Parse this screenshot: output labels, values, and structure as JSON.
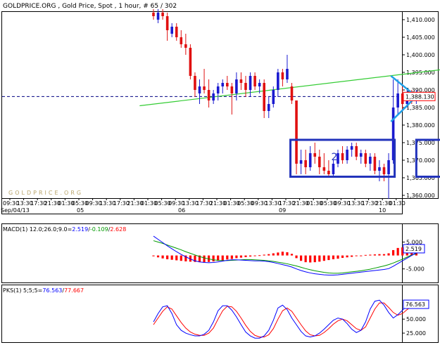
{
  "header": {
    "title": "GOLDPRICE.ORG , Gold Price, Spot , 1 hour, # 65 / 302"
  },
  "watermark": "GOLDPRICE.ORG",
  "colors": {
    "up_candle": "#1a1ad0",
    "down_candle": "#e01010",
    "trendline": "#33cc33",
    "box": "#2233bb",
    "triangle": "#1fa0e8",
    "price_line": "#000080",
    "macd_hist": "#ff0000",
    "macd_line": "#0000ff",
    "signal_line": "#009900",
    "pks_k": "#0000ff",
    "pks_d": "#ff0000",
    "price_tag_border": "#ff0000"
  },
  "annotations": {
    "box2_label": "2"
  },
  "chart_data": [
    {
      "type": "candlestick",
      "title": "GOLDPRICE.ORG , Gold Price, Spot , 1 hour, # 65 / 302",
      "y_ticks": [
        "1,410.000",
        "1,405.000",
        "1,400.000",
        "1,395.000",
        "1,390.000",
        "1,385.000",
        "1,380.000",
        "1,375.000",
        "1,370.000",
        "1,365.000",
        "1,360.000"
      ],
      "ylim": [
        1357.5,
        1413.5
      ],
      "current_price": 1388.13,
      "current_price_label": "1,388.130",
      "x_time_labels": [
        "09:30",
        "13:30",
        "17:30",
        "21:30",
        "01:30",
        "05:30",
        "09:30",
        "13:30",
        "17:30",
        "21:30",
        "01:30",
        "05:30",
        "09:30",
        "13:30",
        "17:30",
        "21:30",
        "01:30",
        "05:30",
        "09:30",
        "13:30",
        "17:30",
        "21:30",
        "01:30",
        "05:30",
        "09:30",
        "13:30",
        "17:30",
        "21:30",
        "01:30"
      ],
      "x_date_labels": [
        "Sep/04/13",
        "05",
        "06",
        "09",
        "10"
      ],
      "candles": [
        {
          "o": 1412,
          "h": 1413,
          "l": 1410,
          "c": 1411
        },
        {
          "o": 1410,
          "h": 1413,
          "l": 1409,
          "c": 1412
        },
        {
          "o": 1412,
          "h": 1413,
          "l": 1410,
          "c": 1411
        },
        {
          "o": 1411,
          "h": 1412,
          "l": 1404,
          "c": 1407
        },
        {
          "o": 1406,
          "h": 1409,
          "l": 1405,
          "c": 1408
        },
        {
          "o": 1408,
          "h": 1409,
          "l": 1404,
          "c": 1405
        },
        {
          "o": 1405,
          "h": 1407,
          "l": 1402,
          "c": 1403
        },
        {
          "o": 1403,
          "h": 1406,
          "l": 1400,
          "c": 1402
        },
        {
          "o": 1402,
          "h": 1403,
          "l": 1393,
          "c": 1394
        },
        {
          "o": 1394,
          "h": 1395,
          "l": 1388,
          "c": 1390
        },
        {
          "o": 1389,
          "h": 1393,
          "l": 1386,
          "c": 1391
        },
        {
          "o": 1391,
          "h": 1396,
          "l": 1389,
          "c": 1390
        },
        {
          "o": 1390,
          "h": 1393,
          "l": 1385,
          "c": 1387
        },
        {
          "o": 1387,
          "h": 1390,
          "l": 1386,
          "c": 1389
        },
        {
          "o": 1389,
          "h": 1392,
          "l": 1387,
          "c": 1391
        },
        {
          "o": 1391,
          "h": 1393,
          "l": 1389,
          "c": 1392
        },
        {
          "o": 1392,
          "h": 1394,
          "l": 1390,
          "c": 1391
        },
        {
          "o": 1391,
          "h": 1392,
          "l": 1383,
          "c": 1389
        },
        {
          "o": 1389,
          "h": 1395,
          "l": 1387,
          "c": 1393
        },
        {
          "o": 1393,
          "h": 1395,
          "l": 1390,
          "c": 1392
        },
        {
          "o": 1392,
          "h": 1394,
          "l": 1388,
          "c": 1390
        },
        {
          "o": 1390,
          "h": 1395,
          "l": 1388,
          "c": 1394
        },
        {
          "o": 1394,
          "h": 1395,
          "l": 1390,
          "c": 1391
        },
        {
          "o": 1391,
          "h": 1393,
          "l": 1389,
          "c": 1392
        },
        {
          "o": 1392,
          "h": 1393,
          "l": 1382,
          "c": 1384
        },
        {
          "o": 1384,
          "h": 1388,
          "l": 1382,
          "c": 1386
        },
        {
          "o": 1386,
          "h": 1391,
          "l": 1385,
          "c": 1390
        },
        {
          "o": 1390,
          "h": 1396,
          "l": 1388,
          "c": 1395
        },
        {
          "o": 1395,
          "h": 1396,
          "l": 1391,
          "c": 1393
        },
        {
          "o": 1393,
          "h": 1400,
          "l": 1392,
          "c": 1396
        },
        {
          "o": 1391,
          "h": 1392,
          "l": 1386,
          "c": 1387
        },
        {
          "o": 1387,
          "h": 1387,
          "l": 1366,
          "c": 1369
        },
        {
          "o": 1369,
          "h": 1373,
          "l": 1366,
          "c": 1370
        },
        {
          "o": 1370,
          "h": 1373,
          "l": 1366,
          "c": 1368
        },
        {
          "o": 1368,
          "h": 1374,
          "l": 1367,
          "c": 1372
        },
        {
          "o": 1372,
          "h": 1375,
          "l": 1369,
          "c": 1371
        },
        {
          "o": 1371,
          "h": 1373,
          "l": 1366,
          "c": 1368
        },
        {
          "o": 1368,
          "h": 1372,
          "l": 1366,
          "c": 1367
        },
        {
          "o": 1367,
          "h": 1370,
          "l": 1365,
          "c": 1366
        },
        {
          "o": 1366,
          "h": 1370,
          "l": 1365,
          "c": 1369
        },
        {
          "o": 1369,
          "h": 1373,
          "l": 1368,
          "c": 1372
        },
        {
          "o": 1372,
          "h": 1374,
          "l": 1369,
          "c": 1370
        },
        {
          "o": 1370,
          "h": 1374,
          "l": 1369,
          "c": 1373
        },
        {
          "o": 1373,
          "h": 1375,
          "l": 1371,
          "c": 1374
        },
        {
          "o": 1374,
          "h": 1375,
          "l": 1370,
          "c": 1371
        },
        {
          "o": 1371,
          "h": 1373,
          "l": 1369,
          "c": 1372
        },
        {
          "o": 1372,
          "h": 1373,
          "l": 1368,
          "c": 1369
        },
        {
          "o": 1369,
          "h": 1372,
          "l": 1367,
          "c": 1371
        },
        {
          "o": 1371,
          "h": 1372,
          "l": 1366,
          "c": 1367
        },
        {
          "o": 1367,
          "h": 1370,
          "l": 1364,
          "c": 1368
        },
        {
          "o": 1368,
          "h": 1369,
          "l": 1364,
          "c": 1366
        },
        {
          "o": 1366,
          "h": 1372,
          "l": 1359,
          "c": 1370
        },
        {
          "o": 1370,
          "h": 1393,
          "l": 1369,
          "c": 1385
        },
        {
          "o": 1385,
          "h": 1393,
          "l": 1383,
          "c": 1389
        },
        {
          "o": 1389,
          "h": 1391,
          "l": 1384,
          "c": 1386
        },
        {
          "o": 1386,
          "h": 1390,
          "l": 1385,
          "c": 1388
        },
        {
          "o": 1388,
          "h": 1390,
          "l": 1386,
          "c": 1387
        },
        {
          "o": 1387,
          "h": 1390,
          "l": 1386,
          "c": 1389
        }
      ],
      "trendline": {
        "from": {
          "i": -3,
          "price": 1385.5
        },
        "to": {
          "i": 97,
          "price": 1401.2
        }
      },
      "boxes": [
        {
          "i0": 29.7,
          "i1": 52.3,
          "top": 1375.8,
          "bottom": 1365.3
        },
        {
          "i0": 57,
          "i1": 79,
          "top": 1375.8,
          "bottom": 1365.3,
          "label": "2"
        }
      ],
      "triangle": {
        "i_left": 51.5,
        "i_apex": 57,
        "top": 1394,
        "bottom": 1381,
        "apex": 1388.13
      }
    },
    {
      "type": "bar+line",
      "title": "MACD(1) 12.0;26.0;9.0=2.519/-0.109/2.628",
      "legend_name": "MACD(1)",
      "legend_params": "12.0;26.0;9.0=",
      "legend_v1": "2.519",
      "legend_v2": "-0.109",
      "legend_v3": "2.628",
      "y_ticks": [
        "5.000",
        "-5.000"
      ],
      "y_values": [
        5,
        -5
      ],
      "ylim": [
        -9,
        8
      ],
      "current_label": "2.519",
      "current_value": 2.519,
      "histogram": [
        -0.3,
        -0.7,
        -1.1,
        -1.4,
        -1.6,
        -1.8,
        -2.0,
        -2.2,
        -2.3,
        -2.4,
        -2.5,
        -2.5,
        -2.4,
        -2.2,
        -2.0,
        -1.8,
        -1.5,
        -1.3,
        -1.0,
        -0.8,
        -0.6,
        -0.4,
        -0.2,
        0.1,
        0.3,
        0.5,
        0.8,
        1.1,
        1.4,
        1.2,
        0.6,
        -1.0,
        -2.0,
        -2.5,
        -2.6,
        -2.5,
        -2.3,
        -2.0,
        -1.7,
        -1.4,
        -1.2,
        -0.9,
        -0.7,
        -0.5,
        -0.2,
        0.0,
        0.2,
        0.3,
        0.4,
        0.5,
        0.5,
        0.8,
        2.0,
        2.8,
        3.0,
        3.0,
        2.8,
        2.6
      ],
      "macd_line": [
        7.2,
        6.0,
        4.8,
        3.6,
        2.5,
        1.4,
        0.4,
        -0.5,
        -1.3,
        -2.0,
        -2.4,
        -2.6,
        -2.7,
        -2.6,
        -2.4,
        -2.1,
        -1.8,
        -1.6,
        -1.6,
        -1.7,
        -1.8,
        -1.9,
        -2.0,
        -2.0,
        -2.1,
        -2.3,
        -2.6,
        -3.0,
        -3.4,
        -3.8,
        -4.3,
        -5.0,
        -5.6,
        -6.1,
        -6.5,
        -6.8,
        -7.0,
        -7.2,
        -7.3,
        -7.3,
        -7.2,
        -7.0,
        -6.8,
        -6.6,
        -6.4,
        -6.2,
        -6.0,
        -5.8,
        -5.6,
        -5.4,
        -5.2,
        -4.9,
        -4.0,
        -3.0,
        -2.0,
        -1.0,
        0.0,
        1.0
      ],
      "signal_line": [
        5.5,
        5.0,
        4.5,
        3.9,
        3.3,
        2.7,
        2.1,
        1.4,
        0.8,
        0.2,
        -0.4,
        -0.9,
        -1.3,
        -1.6,
        -1.8,
        -1.9,
        -1.9,
        -1.8,
        -1.7,
        -1.6,
        -1.5,
        -1.5,
        -1.6,
        -1.7,
        -1.8,
        -2.0,
        -2.2,
        -2.5,
        -2.8,
        -3.1,
        -3.5,
        -3.9,
        -4.4,
        -4.9,
        -5.3,
        -5.7,
        -6.0,
        -6.3,
        -6.5,
        -6.6,
        -6.6,
        -6.5,
        -6.3,
        -6.1,
        -5.9,
        -5.7,
        -5.4,
        -5.1,
        -4.7,
        -4.3,
        -3.9,
        -3.4,
        -2.8,
        -2.1,
        -1.4,
        -0.6,
        0.2,
        0.6
      ]
    },
    {
      "type": "line",
      "title": "PKS(1) 5;5;5=76.563/77.667",
      "legend_name": "PKS(1)",
      "legend_params": "5;5;5=",
      "legend_v1": "76.563",
      "legend_v2": "77.667",
      "y_ticks": [
        "50.000",
        "25.000"
      ],
      "y_values": [
        50,
        25
      ],
      "ylim": [
        10,
        93
      ],
      "current_label": "76.563",
      "current_value": 76.563,
      "k_line": [
        45,
        60,
        72,
        74,
        60,
        40,
        30,
        25,
        22,
        20,
        20,
        23,
        30,
        45,
        65,
        74,
        74,
        66,
        54,
        40,
        27,
        20,
        16,
        16,
        20,
        30,
        48,
        70,
        75,
        67,
        52,
        40,
        28,
        20,
        18,
        20,
        25,
        32,
        40,
        48,
        52,
        50,
        42,
        32,
        26,
        30,
        45,
        68,
        82,
        84,
        75,
        62,
        52,
        58,
        66,
        74,
        77,
        77
      ],
      "d_line": [
        40,
        52,
        64,
        72,
        68,
        56,
        44,
        34,
        27,
        23,
        21,
        21,
        25,
        34,
        50,
        65,
        73,
        72,
        64,
        52,
        39,
        28,
        21,
        18,
        18,
        22,
        33,
        50,
        65,
        70,
        64,
        52,
        40,
        29,
        22,
        20,
        21,
        26,
        33,
        41,
        47,
        50,
        47,
        40,
        33,
        30,
        36,
        52,
        68,
        79,
        79,
        71,
        62,
        57,
        60,
        67,
        73,
        77
      ]
    }
  ]
}
